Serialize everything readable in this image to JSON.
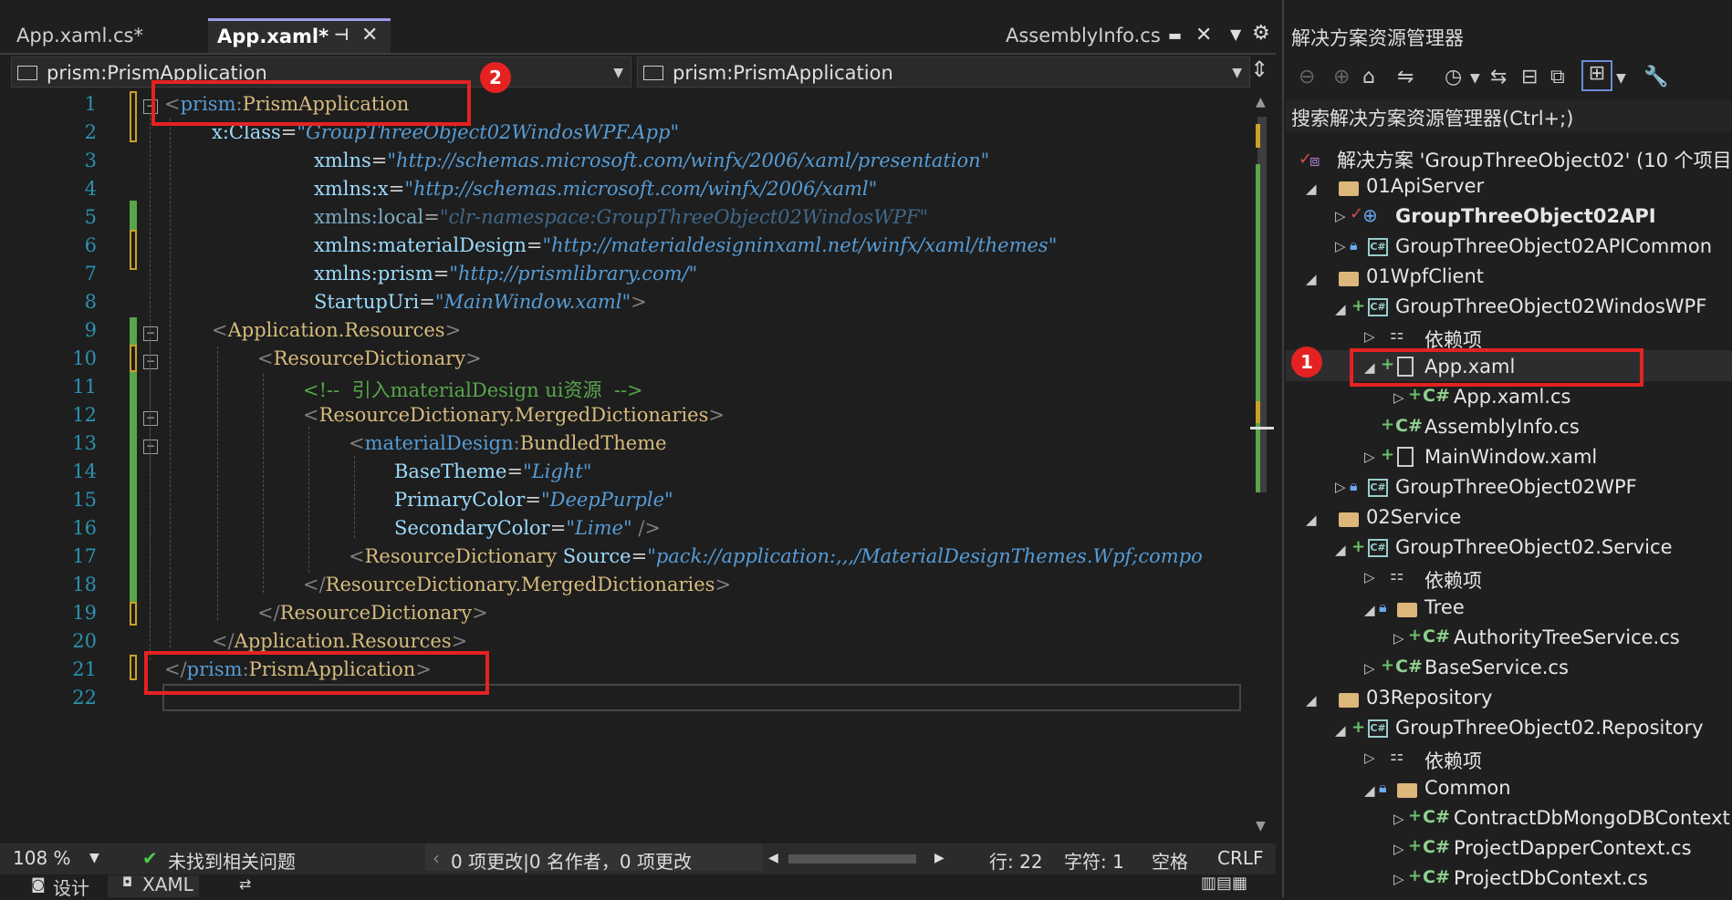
{
  "tabs": {
    "tab1": "App.xaml.cs*",
    "tab2": "App.xaml*",
    "tab3": "AssemblyInfo.cs"
  },
  "nav": {
    "left_selector": "prism:PrismApplication",
    "right_selector": "prism:PrismApplication"
  },
  "badges": {
    "one": "1",
    "two": "2"
  },
  "code_lines": [
    {
      "n": "1"
    },
    {
      "n": "2"
    },
    {
      "n": "3"
    },
    {
      "n": "4"
    },
    {
      "n": "5"
    },
    {
      "n": "6"
    },
    {
      "n": "7"
    },
    {
      "n": "8"
    },
    {
      "n": "9"
    },
    {
      "n": "10"
    },
    {
      "n": "11"
    },
    {
      "n": "12"
    },
    {
      "n": "13"
    },
    {
      "n": "14"
    },
    {
      "n": "15"
    },
    {
      "n": "16"
    },
    {
      "n": "17"
    },
    {
      "n": "18"
    },
    {
      "n": "19"
    },
    {
      "n": "20"
    },
    {
      "n": "21"
    },
    {
      "n": "22"
    }
  ],
  "code": {
    "l1_ns": "prism",
    "l1_name": "PrismApplication",
    "l2_attr": "x:Class",
    "l2_val": "\"GroupThreeObject02WindosWPF.App\"",
    "l3_attr": "xmlns",
    "l3_val": "\"http://schemas.microsoft.com/winfx/2006/xaml/presentation\"",
    "l4_attr": "xmlns:x",
    "l4_val": "\"http://schemas.microsoft.com/winfx/2006/xaml\"",
    "l5_attr": "xmlns:local",
    "l5_val": "\"clr-namespace:GroupThreeObject02WindosWPF\"",
    "l6_attr": "xmlns:materialDesign",
    "l6_val": "\"http://materialdesigninxaml.net/winfx/xaml/themes\"",
    "l7_attr": "xmlns:prism",
    "l7_val": "\"http://prismlibrary.com/\"",
    "l8_attr": "StartupUri",
    "l8_val": "\"MainWindow.xaml\"",
    "l9_name": "Application.Resources",
    "l10_name": "ResourceDictionary",
    "l11_comment": "<!--  引入materialDesign ui资源  -->",
    "l12_name": "ResourceDictionary.MergedDictionaries",
    "l13_ns": "materialDesign",
    "l13_name": "BundledTheme",
    "l14_attr": "BaseTheme",
    "l14_val": "\"Light\"",
    "l15_attr": "PrimaryColor",
    "l15_val": "\"DeepPurple\"",
    "l16_attr": "SecondaryColor",
    "l16_val": "\"Lime\"",
    "l17_name": "ResourceDictionary",
    "l17_attr": "Source",
    "l17_val": "\"pack://application:,,,/MaterialDesignThemes.Wpf;compo",
    "l18_name": "ResourceDictionary.MergedDictionaries",
    "l19_name": "ResourceDictionary",
    "l20_name": "Application.Resources",
    "l21_ns": "prism",
    "l21_name": "PrismApplication"
  },
  "status": {
    "zoom": "108 %",
    "issues": "未找到相关问题",
    "changes": "0 项更改|0 名作者，0 项更改",
    "line": "行: 22",
    "char": "字符: 1",
    "spaces": "空格",
    "eol": "CRLF"
  },
  "bottom": {
    "design": "设计",
    "xaml": "XAML"
  },
  "solution_explorer": {
    "title": "解决方案资源管理器",
    "search": "搜索解决方案资源管理器(Ctrl+;)",
    "items": [
      "解决方案 'GroupThreeObject02' (10 个项目,",
      "01ApiServer",
      "GroupThreeObject02API",
      "GroupThreeObject02APICommon",
      "01WpfClient",
      "GroupThreeObject02WindosWPF",
      "依赖项",
      "App.xaml",
      "App.xaml.cs",
      "AssemblyInfo.cs",
      "MainWindow.xaml",
      "GroupThreeObject02WPF",
      "02Service",
      "GroupThreeObject02.Service",
      "依赖项",
      "Tree",
      "AuthorityTreeService.cs",
      "BaseService.cs",
      "03Repository",
      "GroupThreeObject02.Repository",
      "依赖项",
      "Common",
      "ContractDbMongoDBContext",
      "ProjectDapperContext.cs",
      "ProjectDbContext.cs"
    ]
  },
  "colors": {
    "accent": "#e52222",
    "active_tab": "#9a9ae8"
  }
}
